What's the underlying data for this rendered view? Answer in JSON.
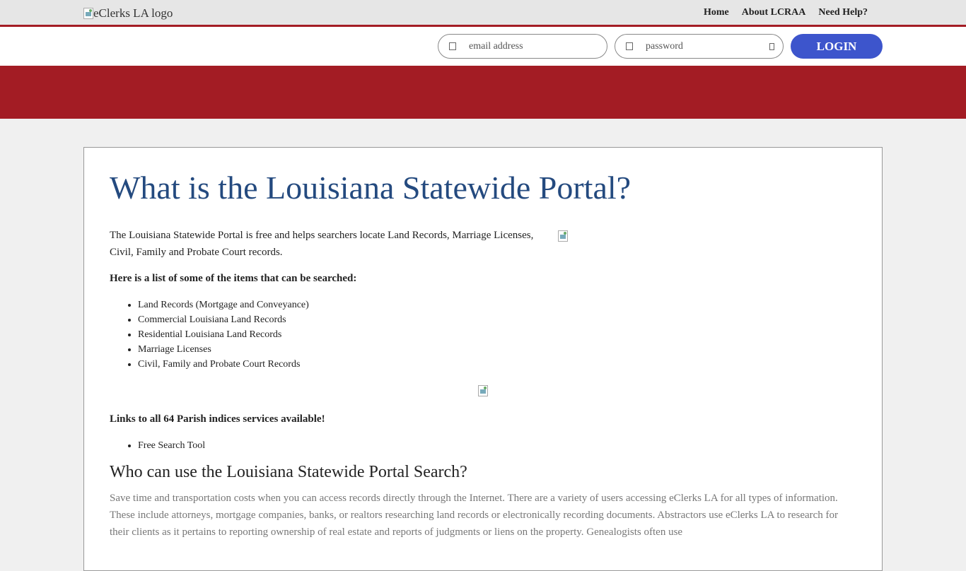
{
  "header": {
    "logo_alt": "eClerks LA logo",
    "nav": [
      "Home",
      "About LCRAA",
      "Need Help?"
    ]
  },
  "login": {
    "email_placeholder": "email address",
    "password_placeholder": "password",
    "button": "LOGIN"
  },
  "colors": {
    "brand_red": "#a31c24",
    "login_blue": "#3d55cc",
    "title_blue": "#244a7f"
  },
  "content": {
    "title": "What is the Louisiana Statewide Portal?",
    "intro": "The Louisiana Statewide Portal is free and helps searchers locate Land Records, Marriage Licenses, Civil, Family and Probate Court records.",
    "list_heading": "Here is a list of some of the items that can be searched:",
    "items": [
      "Land Records (Mortgage and Conveyance)",
      "Commercial Louisiana Land Records",
      "Residential Louisiana Land Records",
      "Marriage Licenses",
      "Civil, Family and Probate Court Records"
    ],
    "links_heading": "Links to all 64 Parish indices services available!",
    "links_items": [
      "Free Search Tool"
    ],
    "subtitle": "Who can use the Louisiana Statewide Portal Search?",
    "description": "Save time and transportation costs when you can access records directly through the Internet. There are a variety of users accessing eClerks LA for all types of information. These include attorneys, mortgage companies, banks, or realtors researching land records or electronically recording documents. Abstractors use eClerks LA to research for their clients as it pertains to reporting ownership of real estate and reports of judgments or liens on the property. Genealogists often use"
  }
}
